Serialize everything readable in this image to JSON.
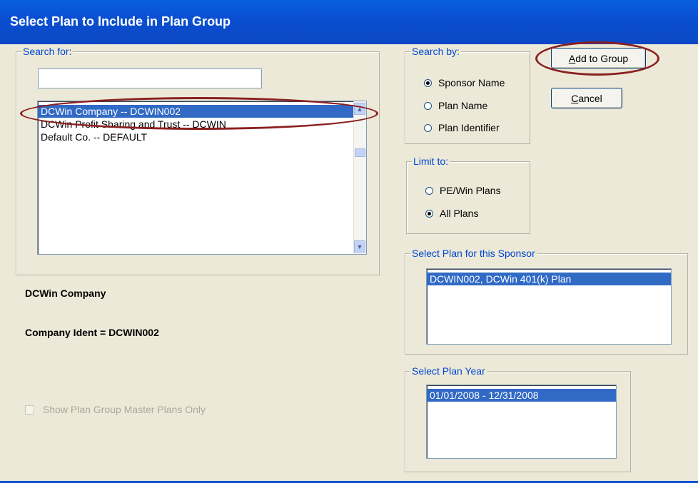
{
  "window": {
    "title": "Select Plan to Include in Plan Group"
  },
  "search_for": {
    "legend": "Search for:",
    "input_value": "",
    "items": [
      "DCWin Company -- DCWIN002",
      "DCWin Profit Sharing and Trust -- DCWIN",
      "Default Co. -- DEFAULT"
    ],
    "selected_index": 0
  },
  "selection_info": {
    "company_name": "DCWin Company",
    "company_ident": "Company Ident = DCWIN002"
  },
  "show_master_only": {
    "label": "Show Plan Group Master Plans Only",
    "checked": false,
    "enabled": false
  },
  "search_by": {
    "legend": "Search by:",
    "options": [
      "Sponsor Name",
      "Plan Name",
      "Plan Identifier"
    ],
    "selected": "Sponsor Name"
  },
  "limit_to": {
    "legend": "Limit to:",
    "options": [
      "PE/Win Plans",
      "All Plans"
    ],
    "selected": "All Plans"
  },
  "buttons": {
    "add_first": "A",
    "add_rest": "dd to Group",
    "cancel_first": "C",
    "cancel_rest": "ancel"
  },
  "select_plan": {
    "legend": "Select Plan for this Sponsor",
    "items": [
      "DCWIN002, DCWin 401(k) Plan"
    ]
  },
  "select_year": {
    "legend": "Select Plan Year",
    "items": [
      "01/01/2008 - 12/31/2008"
    ]
  },
  "colors": {
    "titlebar": "#0a4fd2",
    "legend_text": "#0046d5",
    "selection": "#316ac5",
    "annotation": "#8b2020",
    "window_bg": "#ece9d8"
  }
}
